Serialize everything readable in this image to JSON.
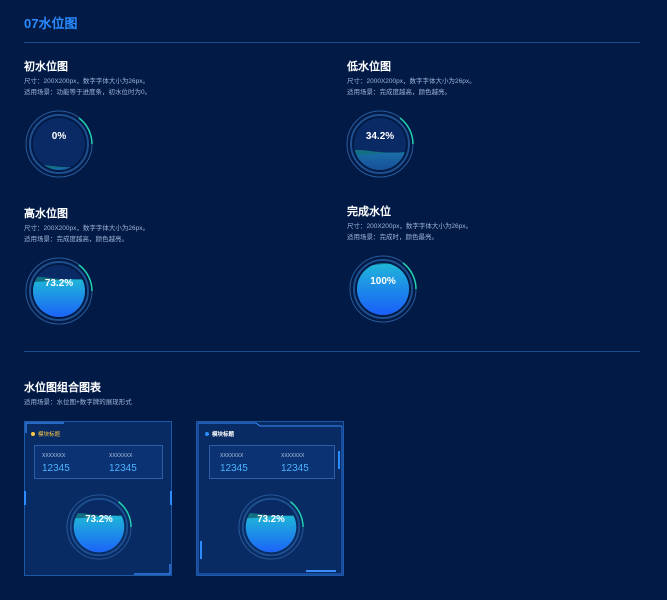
{
  "section": {
    "title": "07水位图"
  },
  "gauges": [
    {
      "title": "初水位图",
      "desc1": "尺寸：200X200px，数字字体大小为26px。",
      "desc2": "适用场景：功能等于进度条，初水位时为0。",
      "percent": 0,
      "label": "0%"
    },
    {
      "title": "低水位图",
      "desc1": "尺寸：2000X200px，数字字体大小为26px。",
      "desc2": "适用场景：完成度越高，颜色越亮。",
      "percent": 34.2,
      "label": "34.2%"
    },
    {
      "title": "高水位图",
      "desc1": "尺寸：200X200px，数字字体大小为26px。",
      "desc2": "适用场景：完成度越高，颜色越亮。",
      "percent": 73.2,
      "label": "73.2%"
    },
    {
      "title": "完成水位",
      "desc1": "尺寸：200X200px，数字字体大小为26px。",
      "desc2": "适用场景：完成时，颜色最亮。",
      "percent": 100,
      "label": "100%"
    }
  ],
  "combo": {
    "title": "水位图组合图表",
    "desc": "适用场景：水位图+数字牌的展现形式",
    "cards": [
      {
        "title": "模块标题",
        "stats": [
          {
            "label": "XXXXXXX",
            "value": "12345"
          },
          {
            "label": "XXXXXXX",
            "value": "12345"
          }
        ],
        "percent": 73.2,
        "gauge_label": "73.2%"
      },
      {
        "title": "模块标题",
        "stats": [
          {
            "label": "XXXXXXX",
            "value": "12345"
          },
          {
            "label": "XXXXXXX",
            "value": "12345"
          }
        ],
        "percent": 73.2,
        "gauge_label": "73.2%"
      }
    ]
  },
  "colors": {
    "background": "#021a46",
    "accent": "#2a8cff",
    "card_title_yellow": "#ffc845"
  }
}
